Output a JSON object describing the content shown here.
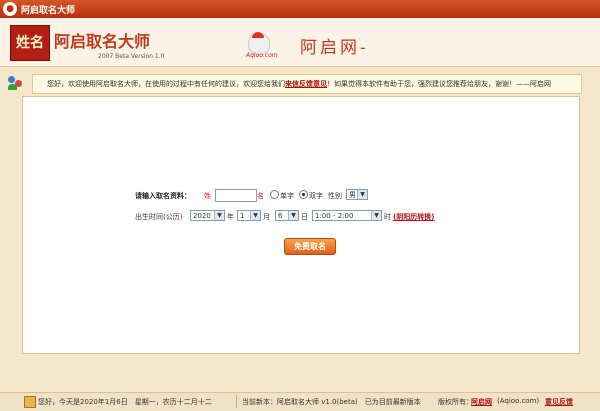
{
  "window": {
    "title": "阿启取名大师"
  },
  "header": {
    "logo_text": "姓名",
    "app_name": "阿启取名大师",
    "version": "2007 Beta Version 1.0",
    "site_logo_text": "Aqioo.com",
    "site_name": "阿启网-"
  },
  "notice": {
    "text_before": "您好，欢迎使用阿启取名大师，在使用的过程中有任何的建议，欢迎您给我们",
    "link": "来信反馈意见",
    "text_after": "！如果觉得本软件有助于您，强烈建议您推荐给朋友，谢谢！——阿启网"
  },
  "form": {
    "prompt": "请输入取名资料：",
    "surname_label": "姓",
    "name_label": "名",
    "single_char": "单字",
    "double_char": "双字",
    "gender_label": "性别",
    "gender_value": "男",
    "birth_label": "出生时间(公历)",
    "year_value": "2020",
    "year_label": "年",
    "month_value": "1",
    "month_label": "月",
    "day_value": "6",
    "day_label": "日",
    "hour_value": "1:00 - 2:00",
    "hour_label": "时",
    "convert_link": "(阴阳历转换)",
    "submit": "免费取名"
  },
  "status": {
    "greeting": "您好，今天是2020年1月6日　星期一，农历十二月十二",
    "current_version": "当前新本：阿启取名大师 v1.0(beta)　已为目前最新版本",
    "copyright_label": "版权所有：",
    "copyright_link": "阿启网",
    "domain": "(Aqioo.com)",
    "feedback": "意见反馈"
  }
}
